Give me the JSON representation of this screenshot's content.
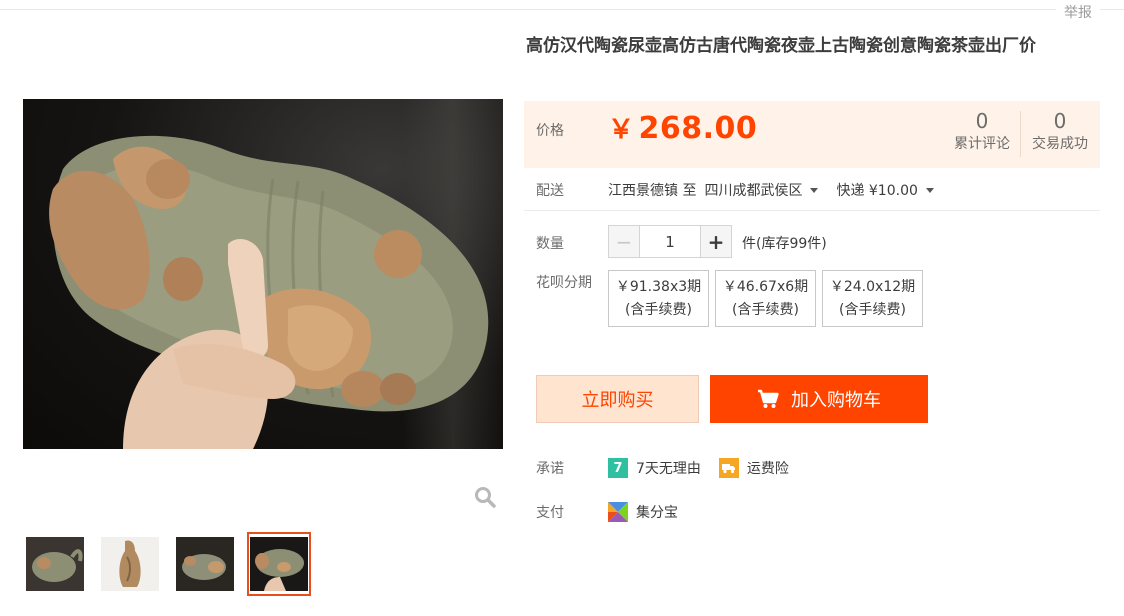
{
  "header": {
    "report_label": "举报"
  },
  "gallery": {
    "thumbnails": [
      {
        "name": "thumb-1"
      },
      {
        "name": "thumb-2"
      },
      {
        "name": "thumb-3"
      },
      {
        "name": "thumb-4",
        "active": true
      }
    ],
    "zoom_icon": "magnifier-icon"
  },
  "product": {
    "title": "高仿汉代陶瓷尿壶高仿古唐代陶瓷夜壶上古陶瓷创意陶瓷茶壶出厂价",
    "price_label": "价格",
    "currency": "￥",
    "price": "268.00",
    "stats": [
      {
        "num": "0",
        "label": "累计评论"
      },
      {
        "num": "0",
        "label": "交易成功"
      }
    ]
  },
  "delivery": {
    "label": "配送",
    "origin": "江西景德镇 至",
    "destination": "四川成都武侯区",
    "shipping": "快递 ¥10.00"
  },
  "quantity": {
    "label": "数量",
    "value": "1",
    "minus": "−",
    "plus": "+",
    "stock": "件(库存99件)"
  },
  "installment": {
    "label": "花呗分期",
    "options": [
      {
        "line1": "￥91.38x3期",
        "line2": "(含手续费)"
      },
      {
        "line1": "￥46.67x6期",
        "line2": "(含手续费)"
      },
      {
        "line1": "￥24.0x12期",
        "line2": "(含手续费)"
      }
    ]
  },
  "actions": {
    "buy_now": "立即购买",
    "add_to_cart": "加入购物车"
  },
  "promise": {
    "label": "承诺",
    "items": [
      {
        "icon": "7",
        "text": "7天无理由"
      },
      {
        "icon": "freight-insurance-icon",
        "text": "运费险"
      }
    ]
  },
  "payment": {
    "label": "支付",
    "method": "集分宝"
  },
  "colors": {
    "accent": "#ff4400",
    "price_bg": "#fff2e8",
    "buy_now_bg": "#ffe4d0"
  }
}
